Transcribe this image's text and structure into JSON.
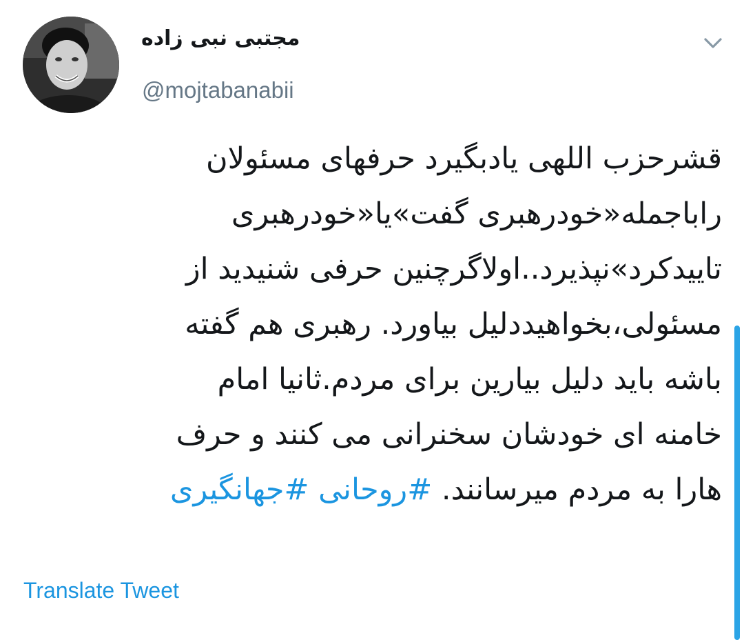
{
  "tweet": {
    "author": {
      "display_name": "مجتبی نبی زاده",
      "handle": "@mojtabanabii",
      "avatar_icon": "profile-photo"
    },
    "menu_icon": "chevron-down-icon",
    "body_lines": [
      "قشرحزب اللهی یادبگیرد حرفهای مسئولان",
      "راباجمله«خودرهبری گفت»یا«خودرهبری",
      "تاییدکرد»نپذیرد..اولاگرچنین حرفی شنیدید از",
      "مسئولی،بخواهیددلیل بیاورد. رهبری هم گفته",
      "باشه باید دلیل بیارین برای مردم.ثانیا امام",
      "خامنه ای خودشان سخنرانی می کنند و حرف"
    ],
    "last_line_text": "هارا به مردم میرسانند.",
    "hashtags": [
      "#روحانی",
      "#جهانگیری"
    ],
    "translate_label": "Translate Tweet"
  },
  "colors": {
    "text": "#14171a",
    "secondary": "#657786",
    "link": "#1b95e0",
    "scrollbar": "#2ba4e6"
  }
}
